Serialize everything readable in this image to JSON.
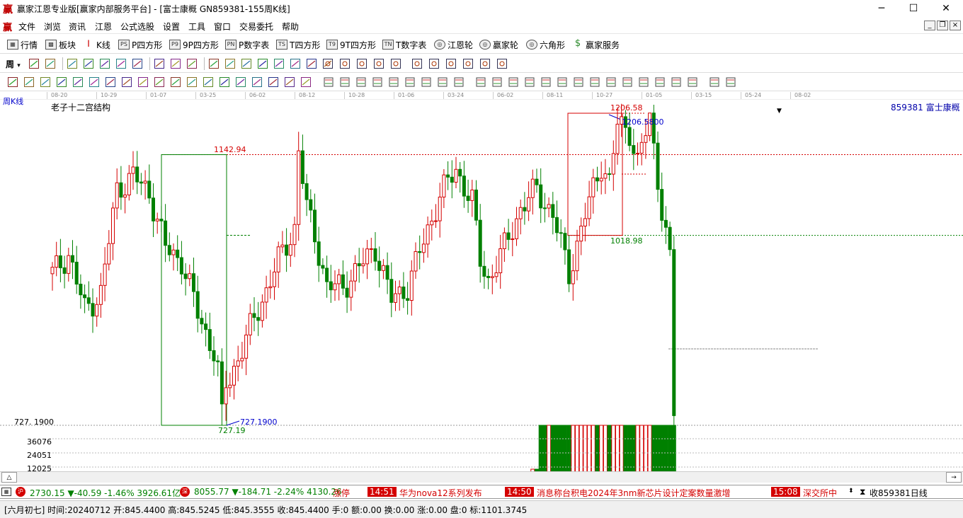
{
  "window": {
    "icon_text": "赢",
    "title": "赢家江恩专业版[赢家内部服务平台] - [富士康概  GN859381-155周K线]",
    "minimize": "─",
    "maximize": "☐",
    "close": "✕"
  },
  "menu": {
    "icon_text": "赢",
    "items": [
      "文件",
      "浏览",
      "资讯",
      "江恩",
      "公式选股",
      "设置",
      "工具",
      "窗口",
      "交易委托",
      "帮助"
    ],
    "mdi_min": "_",
    "mdi_restore": "❐",
    "mdi_close": "×"
  },
  "toolbar1": {
    "items": [
      {
        "label": "行情",
        "icon": "grid-icon"
      },
      {
        "label": "板块",
        "icon": "blocks-icon"
      },
      {
        "label": "K线",
        "icon": "candlestick-icon"
      },
      {
        "label": "P四方形",
        "icon": "ps-icon",
        "abbr": "PS"
      },
      {
        "label": "9P四方形",
        "icon": "p9-icon",
        "abbr": "P9"
      },
      {
        "label": "P数字表",
        "icon": "pn-icon",
        "abbr": "PN"
      },
      {
        "label": "T四方形",
        "icon": "ts-icon",
        "abbr": "TS"
      },
      {
        "label": "9T四方形",
        "icon": "t9-icon",
        "abbr": "T9"
      },
      {
        "label": "T数字表",
        "icon": "tn-icon",
        "abbr": "TN"
      },
      {
        "label": "江恩轮",
        "icon": "gann-wheel-icon",
        "abbr": "◎"
      },
      {
        "label": "赢家轮",
        "icon": "winner-wheel-icon",
        "abbr": "◎"
      },
      {
        "label": "六角形",
        "icon": "hexagon-icon",
        "abbr": "◎"
      },
      {
        "label": "赢家服务",
        "icon": "dollar-icon",
        "abbr": "$"
      }
    ]
  },
  "toolbar2": {
    "period_label": "周",
    "period_arrow": "▾"
  },
  "chart": {
    "title": "老子十二宫结构",
    "period_label": "周K线",
    "symbol": "859381  富士康概",
    "marker_symbol": "▼",
    "labels": {
      "high_box": "1206.58",
      "high_point": "1206.5800",
      "level_upper": "1142.94",
      "level_lower": "1018.98",
      "low_point": "727.1900",
      "low_value": "727.19"
    },
    "y_axis": {
      "price_ref": "727. 1900",
      "volume_ticks": [
        "36076",
        "24051",
        "12025"
      ]
    },
    "time_ticks": [
      "08-20",
      "10-29",
      "01-07",
      "03-25",
      "06-02",
      "08-12",
      "10-28",
      "01-06",
      "03-24",
      "06-02",
      "08-11",
      "10-27",
      "01-05",
      "03-15",
      "05-24",
      "08-02"
    ],
    "colors": {
      "up": "#d40000",
      "down": "#008000",
      "level": "#d40000",
      "box_green": "#008000",
      "box_red": "#d40000",
      "label_blue": "#0000cc"
    }
  },
  "ticker": {
    "sh_index": "2730.15 ▼-40.59 -1.46% 3926.61亿",
    "sz_index": "8055.77 ▼-184.71 -2.24% 4130.26",
    "news": [
      {
        "time": "",
        "text": "涨停"
      },
      {
        "time": "14:51",
        "text": "华为nova12系列发布"
      },
      {
        "time": "14:50",
        "text": "消息称台积电2024年3nm新芯片设计定案数量激增"
      },
      {
        "time": "15:08",
        "text": "深交所中"
      }
    ],
    "right": "收859381日线"
  },
  "status": {
    "text": "[六月初七] 时间:20240712 开:845.4400 高:845.5245 低:845.3555 收:845.4400 手:0 额:0.00 换:0.00 涨:0.00 盘:0 标:1101.3745"
  }
}
